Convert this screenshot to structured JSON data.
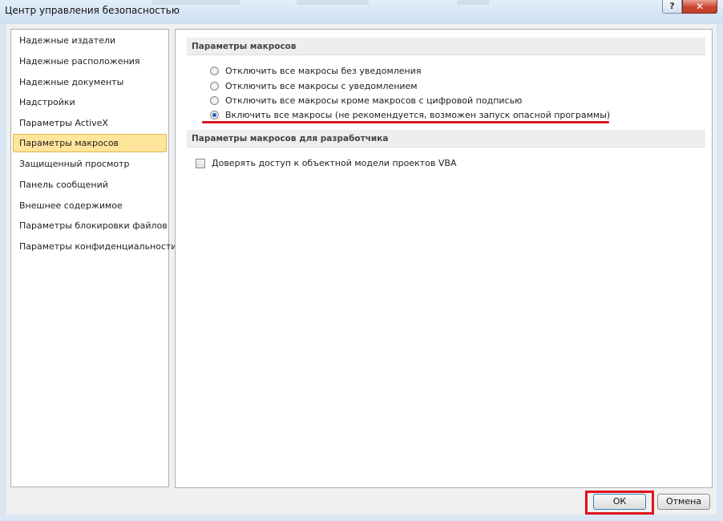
{
  "window": {
    "title": "Центр управления безопасностью",
    "help_glyph": "?",
    "close_glyph": "✕"
  },
  "sidebar": {
    "items": [
      {
        "label": "Надежные издатели",
        "selected": false
      },
      {
        "label": "Надежные расположения",
        "selected": false
      },
      {
        "label": "Надежные документы",
        "selected": false
      },
      {
        "label": "Надстройки",
        "selected": false
      },
      {
        "label": "Параметры ActiveX",
        "selected": false
      },
      {
        "label": "Параметры макросов",
        "selected": true
      },
      {
        "label": "Защищенный просмотр",
        "selected": false
      },
      {
        "label": "Панель сообщений",
        "selected": false
      },
      {
        "label": "Внешнее содержимое",
        "selected": false
      },
      {
        "label": "Параметры блокировки файлов",
        "selected": false
      },
      {
        "label": "Параметры конфиденциальности",
        "selected": false
      }
    ]
  },
  "macro_settings": {
    "header": "Параметры макросов",
    "options": [
      {
        "label": "Отключить все макросы без уведомления",
        "checked": false
      },
      {
        "label": "Отключить все макросы с уведомлением",
        "checked": false
      },
      {
        "label": "Отключить все макросы кроме макросов с цифровой подписью",
        "checked": false
      },
      {
        "label": "Включить все макросы (не рекомендуется, возможен запуск опасной программы)",
        "checked": true
      }
    ]
  },
  "developer_settings": {
    "header": "Параметры макросов для разработчика",
    "checkbox_label": "Доверять доступ к объектной модели проектов VBA",
    "checked": false
  },
  "footer": {
    "ok_label": "ОК",
    "cancel_label": "Отмена"
  },
  "annotations": {
    "color": "#e0121b"
  }
}
